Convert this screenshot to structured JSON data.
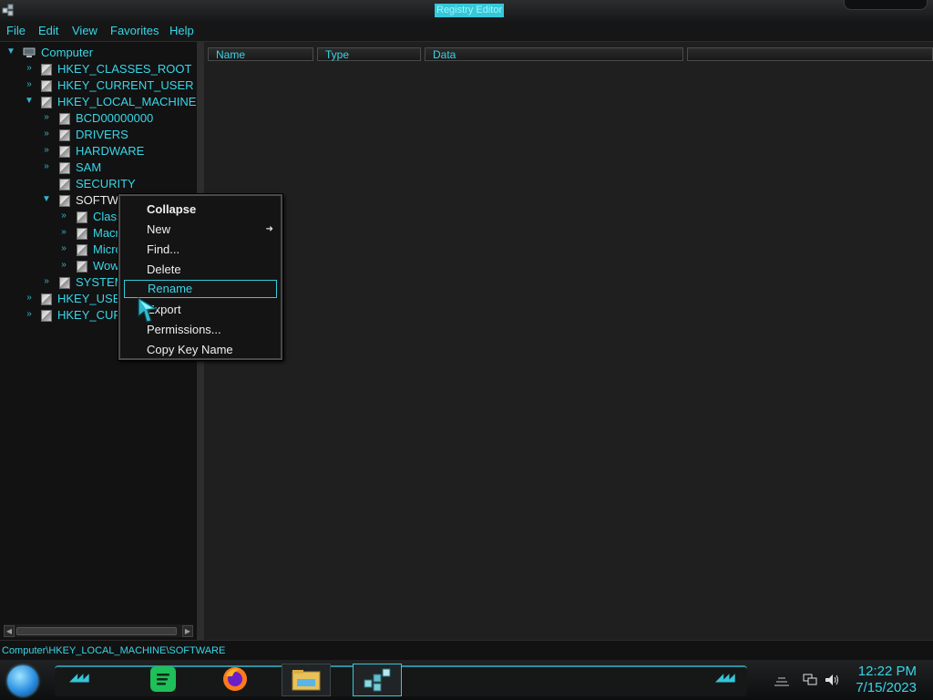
{
  "window": {
    "title": "Registry Editor"
  },
  "menubar": [
    "File",
    "Edit",
    "View",
    "Favorites",
    "Help"
  ],
  "tree": {
    "root": "Computer",
    "hkeys": [
      "HKEY_CLASSES_ROOT",
      "HKEY_CURRENT_USER",
      "HKEY_LOCAL_MACHINE"
    ],
    "hklm_children": [
      "BCD00000000",
      "DRIVERS",
      "HARDWARE",
      "SAM",
      "SECURITY",
      "SOFTW"
    ],
    "software_children": [
      "Class",
      "Macr",
      "Micro",
      "Wow"
    ],
    "after_software": [
      "SYSTEM",
      "HKEY_USE",
      "HKEY_CUR"
    ]
  },
  "columns": [
    "Name",
    "Type",
    "Data"
  ],
  "status_path": "Computer\\HKEY_LOCAL_MACHINE\\SOFTWARE",
  "context_menu": {
    "items": [
      "Collapse",
      "New",
      "Find...",
      "Delete",
      "Rename",
      "Export",
      "Permissions...",
      "Copy Key Name"
    ],
    "highlighted": "Rename"
  },
  "clock": {
    "time": "12:22 PM",
    "date": "7/15/2023"
  },
  "colors": {
    "accent": "#38d6e8",
    "background": "#1b1b1b"
  },
  "icons": [
    "registry-app-icon",
    "start-orb-icon",
    "spotify-icon",
    "firefox-icon",
    "file-explorer-icon",
    "registry-editor-icon",
    "network-icon",
    "volume-icon"
  ]
}
